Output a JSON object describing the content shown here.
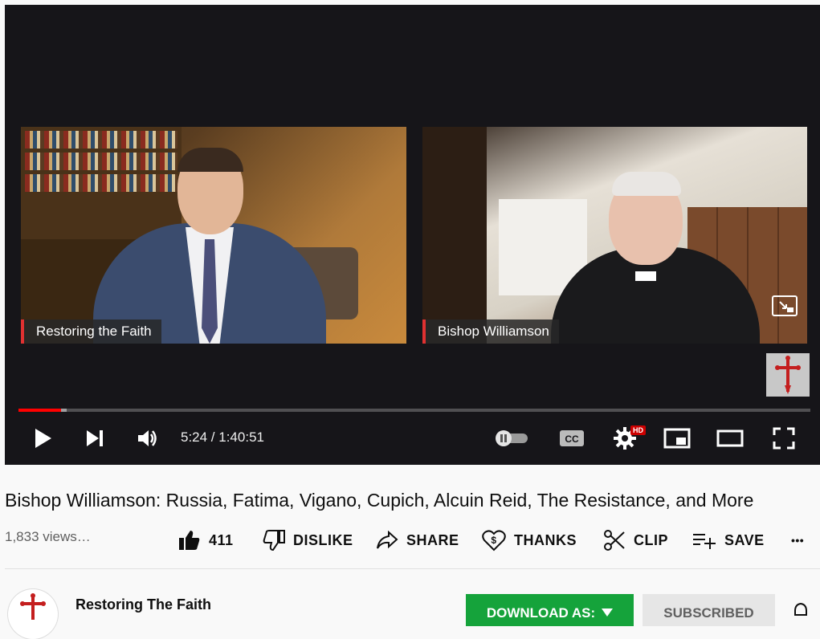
{
  "player": {
    "participants": [
      {
        "name": "Restoring the Faith"
      },
      {
        "name": "Bishop Williamson"
      }
    ],
    "time_display": "5:24 / 1:40:51",
    "progress_fraction": 0.054,
    "buffered_fraction": 0.061,
    "hd_badge": "HD",
    "cc_label": "CC",
    "icons": [
      "play-icon",
      "next-icon",
      "volume-icon",
      "autoplay-toggle-icon",
      "captions-icon",
      "settings-icon",
      "miniplayer-icon",
      "theater-icon",
      "fullscreen-icon",
      "cross-logo-icon"
    ]
  },
  "video": {
    "title": "Bishop Williamson: Russia, Fatima, Vigano, Cupich, Alcuin Reid, The Resistance, and More",
    "views": "1,833 views…"
  },
  "actions": {
    "like_count": "411",
    "dislike_label": "DISLIKE",
    "share_label": "SHARE",
    "thanks_label": "THANKS",
    "clip_label": "CLIP",
    "save_label": "SAVE",
    "more_label": "•••"
  },
  "channel": {
    "name": "Restoring The Faith",
    "download_label": "DOWNLOAD AS:",
    "subscribed_label": "SUBSCRIBED"
  },
  "colors": {
    "accent_red": "#ff0000",
    "download_green": "#15a33b",
    "cross_red": "#c41e1e"
  }
}
